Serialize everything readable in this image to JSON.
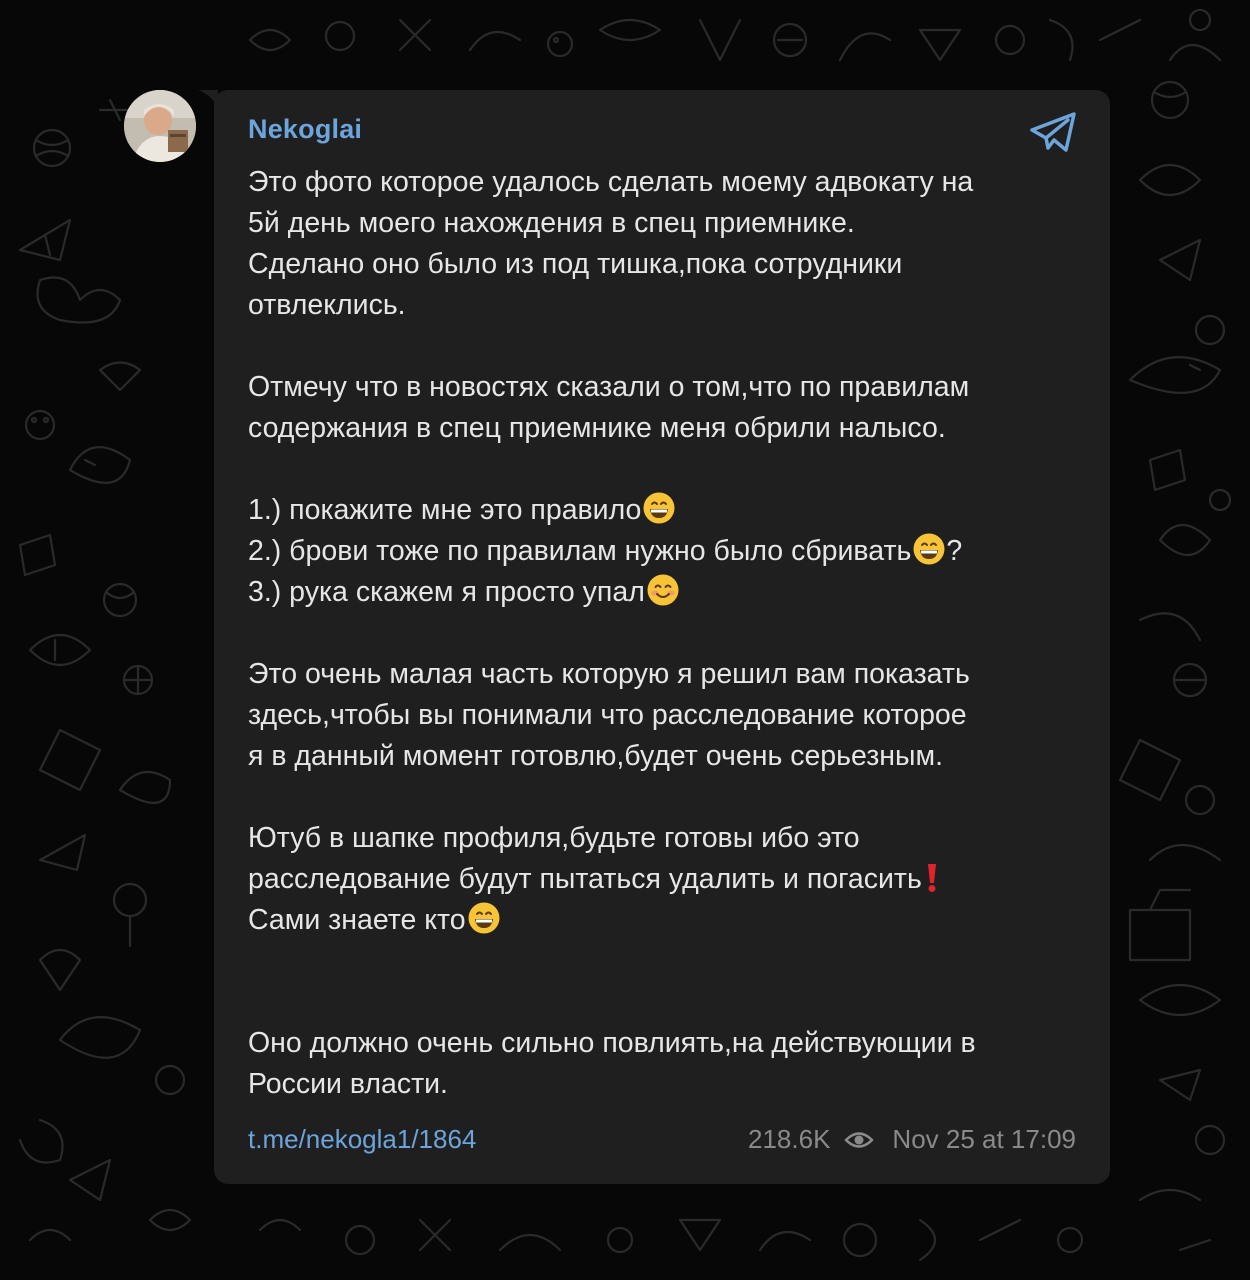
{
  "channel": {
    "name": "Nekoglai"
  },
  "message": {
    "p1": {
      "l1": "Это фото которое удалось сделать моему адвокату на",
      "l2": "5й день моего нахождения в спец приемнике.",
      "l3": "Сделано оно было из под тишка,пока сотрудники",
      "l4": "отвлеклись."
    },
    "p2": {
      "l1": "Отмечу что в новостях сказали о том,что по правилам",
      "l2": "содержания в спец приемнике меня обрили налысо."
    },
    "list": {
      "item1": "1.) покажите мне это правило",
      "item2": "2.) брови тоже по правилам нужно было сбривать",
      "item2_suffix": "?",
      "item3": "3.) рука скажем я просто упал"
    },
    "p3": {
      "l1": "Это очень малая часть которую я решил вам показать",
      "l2": "здесь,чтобы вы понимали что расследование которое",
      "l3": "я в данный момент готовлю,будет очень серьезным."
    },
    "p4": {
      "l1": "Ютуб в шапке профиля,будьте готовы ибо это",
      "l2": "расследование будут пытаться удалить и погасить",
      "l3": "Сами знаете кто"
    },
    "p5": {
      "l1": "Оно должно очень сильно повлиять,на действующии в",
      "l2": "России власти."
    }
  },
  "footer": {
    "link": "t.me/nekogla1/1864",
    "views": "218.6K",
    "date": "Nov 25 at 17:09"
  },
  "icons": {
    "share": "telegram-paper-plane-icon",
    "views": "eye-icon",
    "emoji_grin": "grinning-face-emoji",
    "emoji_smile": "smiling-face-emoji",
    "emoji_exclamation": "red-exclamation-emoji"
  },
  "colors": {
    "background": "#070707",
    "bubble": "#1f1f1f",
    "text": "#e6e6e6",
    "accent": "#6ca4dc",
    "meta": "#8a8a8a"
  }
}
